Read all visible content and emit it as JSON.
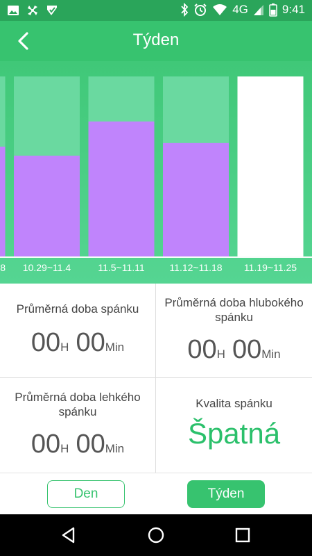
{
  "status_bar": {
    "time": "9:41",
    "network": "4G",
    "icons": [
      "image-icon",
      "fan-icon",
      "check-icon",
      "bluetooth-icon",
      "alarm-icon",
      "wifi-icon",
      "signal-icon",
      "battery-icon"
    ]
  },
  "header": {
    "title": "Týden",
    "back_icon": "chevron-left-icon"
  },
  "chart_data": {
    "type": "bar",
    "categories": [
      "8",
      "10.29~11.4",
      "11.5~11.11",
      "11.12~11.18",
      "11.19~11.25"
    ],
    "series": [
      {
        "name": "",
        "values": [
          0.61,
          0.56,
          0.75,
          0.63,
          0
        ]
      },
      {
        "name": "",
        "values": [
          1,
          1,
          1,
          1,
          0
        ]
      }
    ],
    "ylim": [
      0,
      1
    ],
    "selected_category": "11.19~11.25",
    "colors": {
      "deep": "#c084fc",
      "light": "#6ad9a0",
      "selected": "#ffffff",
      "background": "#43ca7b"
    }
  },
  "stats": {
    "avg_sleep": {
      "label": "Průměrná doba spánku",
      "hours": "00",
      "h_unit": "H",
      "minutes": "00",
      "m_unit": "Min"
    },
    "avg_deep": {
      "label": "Průměrná doba hlubokého spánku",
      "hours": "00",
      "h_unit": "H",
      "minutes": "00",
      "m_unit": "Min"
    },
    "avg_light": {
      "label": "Průměrná doba lehkého spánku",
      "hours": "00",
      "h_unit": "H",
      "minutes": "00",
      "m_unit": "Min"
    },
    "quality": {
      "label": "Kvalita spánku",
      "value": "Špatná",
      "color": "#2bc06b"
    }
  },
  "tabs": {
    "day": "Den",
    "week": "Týden",
    "active": "week"
  },
  "nav": {
    "icons": [
      "back-triangle-icon",
      "home-circle-icon",
      "recents-square-icon"
    ]
  }
}
